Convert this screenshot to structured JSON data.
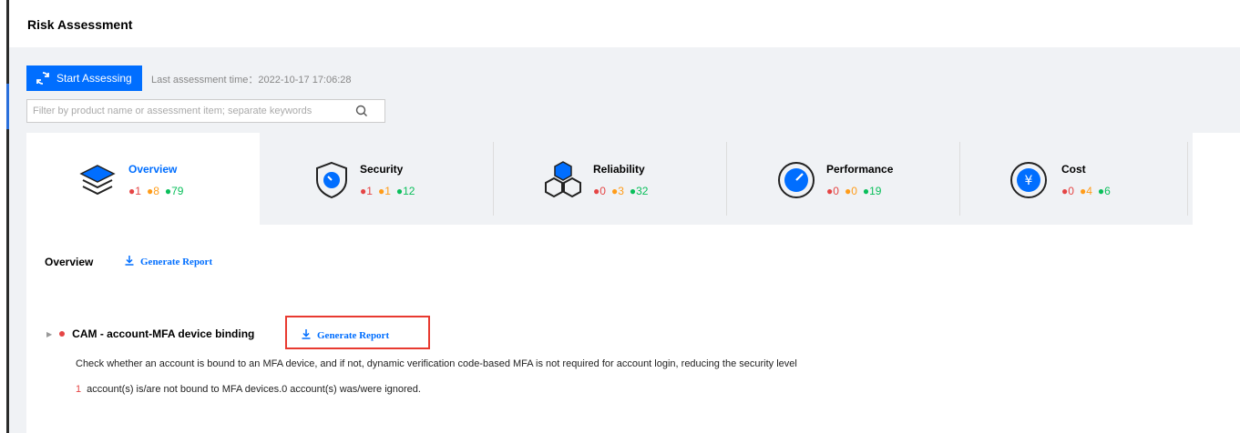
{
  "page": {
    "title": "Risk Assessment"
  },
  "toolbar": {
    "start_label": "Start Assessing",
    "last_time_label": "Last assessment time：2022-10-17 17:06:28"
  },
  "search": {
    "placeholder": "Filter by product name or assessment item; separate keywords"
  },
  "tabs": [
    {
      "label": "Overview",
      "red": "1",
      "orange": "8",
      "green": "79",
      "icon": "layers-icon"
    },
    {
      "label": "Security",
      "red": "1",
      "orange": "1",
      "green": "12",
      "icon": "shield-icon"
    },
    {
      "label": "Reliability",
      "red": "0",
      "orange": "3",
      "green": "32",
      "icon": "cubes-icon"
    },
    {
      "label": "Performance",
      "red": "0",
      "orange": "0",
      "green": "19",
      "icon": "gauge-icon"
    },
    {
      "label": "Cost",
      "red": "0",
      "orange": "4",
      "green": "6",
      "icon": "yen-icon"
    }
  ],
  "overview": {
    "title": "Overview",
    "generate_label": "Generate Report"
  },
  "item": {
    "title": "CAM - account-MFA device binding",
    "generate_label": "Generate Report",
    "description": "Check whether an account is bound to an MFA device, and if not, dynamic verification code-based MFA is not required for account login, reducing the security level",
    "count": "1",
    "stat_text": "account(s) is/are not bound to MFA devices.0  account(s) was/were ignored."
  },
  "colors": {
    "accent": "#006eff",
    "red": "#e54545",
    "orange": "#ff9c19",
    "green": "#0abf5b",
    "highlight": "#e83a30"
  }
}
